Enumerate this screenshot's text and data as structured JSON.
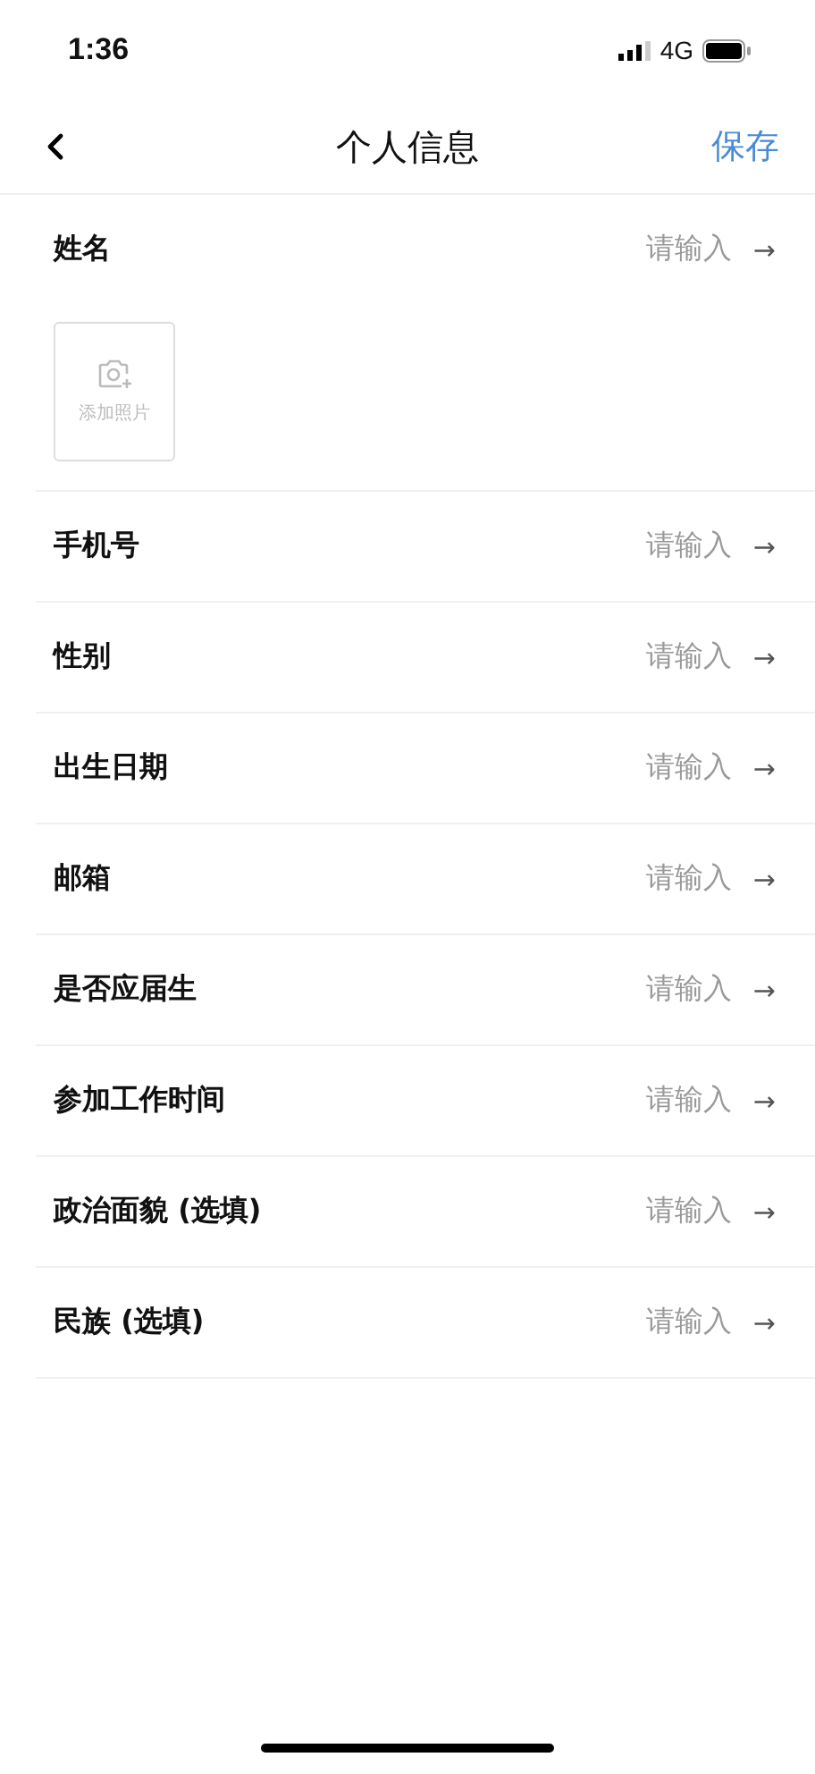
{
  "status_bar": {
    "time": "1:36",
    "network": "4G"
  },
  "nav": {
    "title": "个人信息",
    "action": "保存"
  },
  "name_field": {
    "label": "姓名",
    "placeholder": "请输入",
    "arrow": "→"
  },
  "photo": {
    "label": "添加照片"
  },
  "fields": [
    {
      "label": "手机号",
      "placeholder": "请输入",
      "arrow": "→"
    },
    {
      "label": "性别",
      "placeholder": "请输入",
      "arrow": "→"
    },
    {
      "label": "出生日期",
      "placeholder": "请输入",
      "arrow": "→"
    },
    {
      "label": "邮箱",
      "placeholder": "请输入",
      "arrow": "→"
    },
    {
      "label": "是否应届生",
      "placeholder": "请输入",
      "arrow": "→"
    },
    {
      "label": "参加工作时间",
      "placeholder": "请输入",
      "arrow": "→"
    },
    {
      "label": "政治面貌 (选填)",
      "placeholder": "请输入",
      "arrow": "→"
    },
    {
      "label": "民族 (选填)",
      "placeholder": "请输入",
      "arrow": "→"
    }
  ]
}
